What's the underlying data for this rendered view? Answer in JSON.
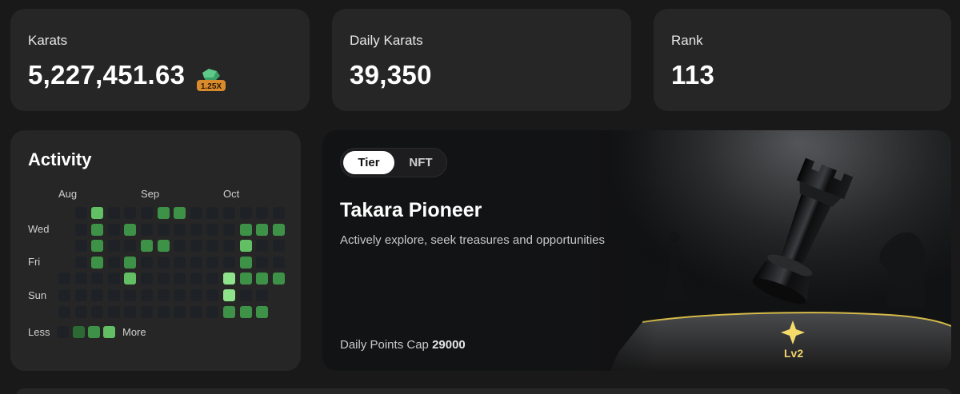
{
  "stats": [
    {
      "label": "Karats",
      "value": "5,227,451.63",
      "badge": "1.25X"
    },
    {
      "label": "Daily Karats",
      "value": "39,350"
    },
    {
      "label": "Rank",
      "value": "113"
    }
  ],
  "activity": {
    "title": "Activity",
    "months": [
      "Aug",
      "Sep",
      "Oct"
    ],
    "days": [
      "Wed",
      "Fri",
      "Sun"
    ],
    "legend": {
      "less": "Less",
      "more": "More"
    },
    "levels": [
      [
        -1,
        0,
        3,
        0,
        0,
        0,
        2,
        2,
        0,
        0,
        0,
        0,
        0,
        0
      ],
      [
        -1,
        0,
        2,
        0,
        2,
        0,
        0,
        0,
        0,
        0,
        0,
        2,
        2,
        2
      ],
      [
        -1,
        0,
        2,
        0,
        0,
        2,
        2,
        0,
        0,
        0,
        0,
        3,
        0,
        0
      ],
      [
        -1,
        0,
        2,
        0,
        2,
        0,
        0,
        0,
        0,
        0,
        0,
        2,
        0,
        0
      ],
      [
        0,
        0,
        0,
        0,
        3,
        0,
        0,
        0,
        0,
        0,
        4,
        2,
        2,
        2
      ],
      [
        0,
        0,
        0,
        0,
        0,
        0,
        0,
        0,
        0,
        0,
        4,
        0,
        0,
        -1
      ],
      [
        0,
        0,
        0,
        0,
        0,
        0,
        0,
        0,
        0,
        0,
        2,
        2,
        2,
        -1
      ]
    ],
    "colors": {
      "empty": "#1e2227",
      "l1": "#2c6a33",
      "l2": "#3e9248",
      "l3": "#62bf64",
      "l4": "#8fe38b"
    }
  },
  "tier_card": {
    "tabs": [
      "Tier",
      "NFT"
    ],
    "selected_tab": "Tier",
    "name": "Takara Pioneer",
    "description": "Actively explore, seek treasures and opportunities",
    "cap_label": "Daily Points Cap",
    "cap_value": "29000",
    "level": "Lv2"
  }
}
